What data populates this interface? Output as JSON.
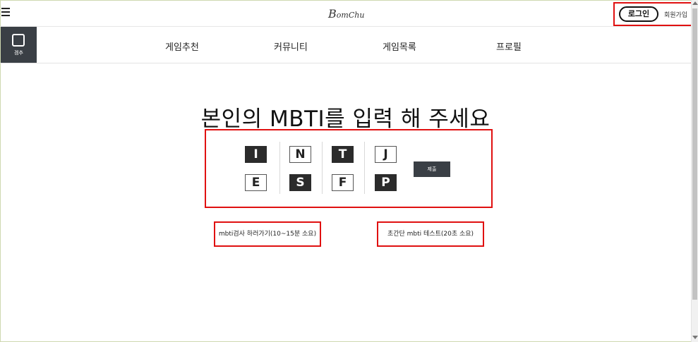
{
  "header": {
    "logo_mark": "B",
    "logo_text": "omChu",
    "login_label": "로그인",
    "signup_label": "회원가입"
  },
  "brand": {
    "label": "겜추"
  },
  "nav": {
    "items": [
      {
        "label": "게임추천"
      },
      {
        "label": "커뮤니티"
      },
      {
        "label": "게임목록"
      },
      {
        "label": "프로필"
      }
    ]
  },
  "main": {
    "title": "본인의 MBTI를 입력 해 주세요",
    "mbti_columns": [
      {
        "top": {
          "letter": "I",
          "selected": true
        },
        "bottom": {
          "letter": "E",
          "selected": false
        }
      },
      {
        "top": {
          "letter": "N",
          "selected": false
        },
        "bottom": {
          "letter": "S",
          "selected": true
        }
      },
      {
        "top": {
          "letter": "T",
          "selected": true
        },
        "bottom": {
          "letter": "F",
          "selected": false
        }
      },
      {
        "top": {
          "letter": "J",
          "selected": false
        },
        "bottom": {
          "letter": "P",
          "selected": true
        }
      }
    ],
    "submit_label": "제출",
    "test_links": [
      {
        "label": "mbti검사 하러가기(10~15분 소요)"
      },
      {
        "label": "초간단 mbti 테스트(20초 소요)"
      }
    ]
  }
}
